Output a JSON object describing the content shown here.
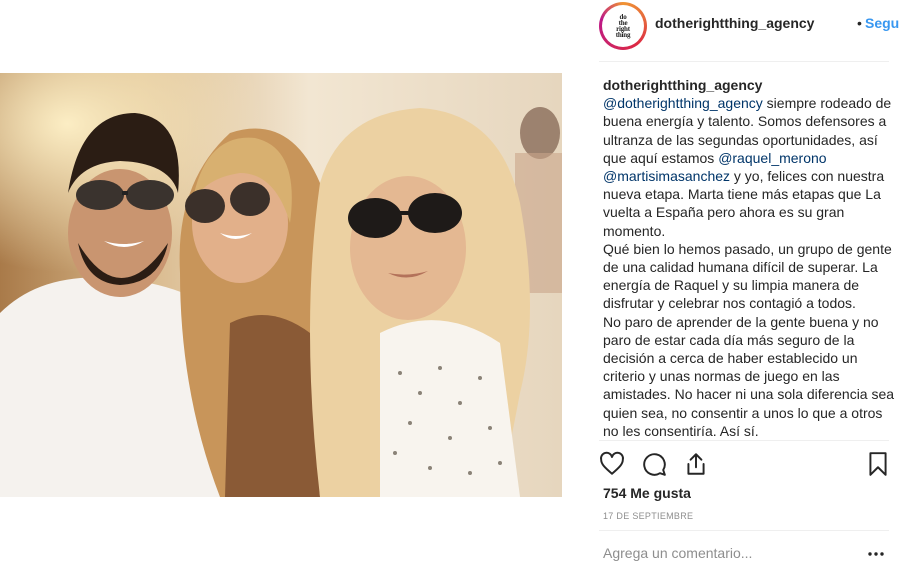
{
  "post": {
    "username": "dotherightthing_agency",
    "separator": "•",
    "follow_label": "Seguir",
    "avatar_logo_lines": [
      "do",
      "the",
      "right",
      "thing"
    ],
    "photo_alt": "Foto de la publicación",
    "caption": {
      "parts": [
        {
          "t": "user",
          "v": "dotherightthing_agency"
        },
        {
          "t": "text",
          "v": " "
        },
        {
          "t": "mention",
          "v": "@dotherightthing_agency"
        },
        {
          "t": "text",
          "v": " siempre rodeado de buena energía y talento. Somos defensores a ultranza de las segundas oportunidades, así que aquí estamos "
        },
        {
          "t": "mention",
          "v": "@raquel_merono"
        },
        {
          "t": "text",
          "v": " "
        },
        {
          "t": "mention",
          "v": "@martisimasanchez"
        },
        {
          "t": "text",
          "v": " y yo, felices con nuestra nueva etapa. Marta tiene más etapas que La vuelta a España pero ahora es su gran momento."
        }
      ],
      "paragraphs": [
        "Qué bien lo hemos pasado, un grupo de gente de una calidad humana difícil de superar. La energía de Raquel y su limpia manera de disfrutar y celebrar nos contagió a todos.",
        "No paro de aprender de la gente buena y no paro de estar cada día más seguro de la decisión a cerca de haber establecido un criterio y unas normas de juego en las amistades. No hacer ni una sola diferencia sea quien sea, no consentir a unos lo que a otros no les consentiría. Así sí."
      ]
    },
    "actions": {
      "like_icon": "heart-icon",
      "comment_icon": "comment-icon",
      "share_icon": "share-icon",
      "save_icon": "bookmark-icon"
    },
    "likes_text": "754 Me gusta",
    "date_text": "17 DE SEPTIEMBRE",
    "comment_placeholder": "Agrega un comentario...",
    "more_icon": "more-options-icon",
    "colors": {
      "follow_blue": "#3897f0",
      "mention_blue": "#003569",
      "text": "#262626",
      "muted": "#8e8e8e",
      "divider": "#efefef"
    }
  }
}
